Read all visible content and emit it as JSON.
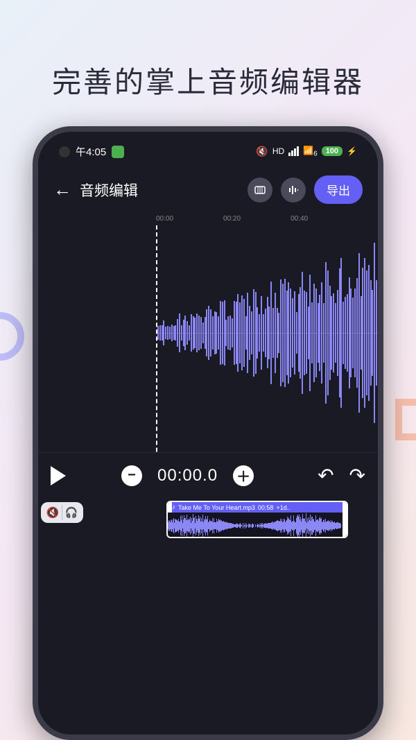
{
  "headline": "完善的掌上音频编辑器",
  "status": {
    "time": "午4:05",
    "hd": "HD",
    "wifi_x": "6",
    "battery": "100"
  },
  "appbar": {
    "title": "音频编辑",
    "export": "导出"
  },
  "ruler": {
    "t0": "00:00",
    "t1": "00:20",
    "t2": "00:40"
  },
  "controls": {
    "minus": "−",
    "time": "00:00.0",
    "plus": "＋"
  },
  "clip": {
    "name": "Take Me To Your Heart.mp3",
    "dur": "00:58",
    "gain": "+1d..",
    "note": "♪"
  }
}
